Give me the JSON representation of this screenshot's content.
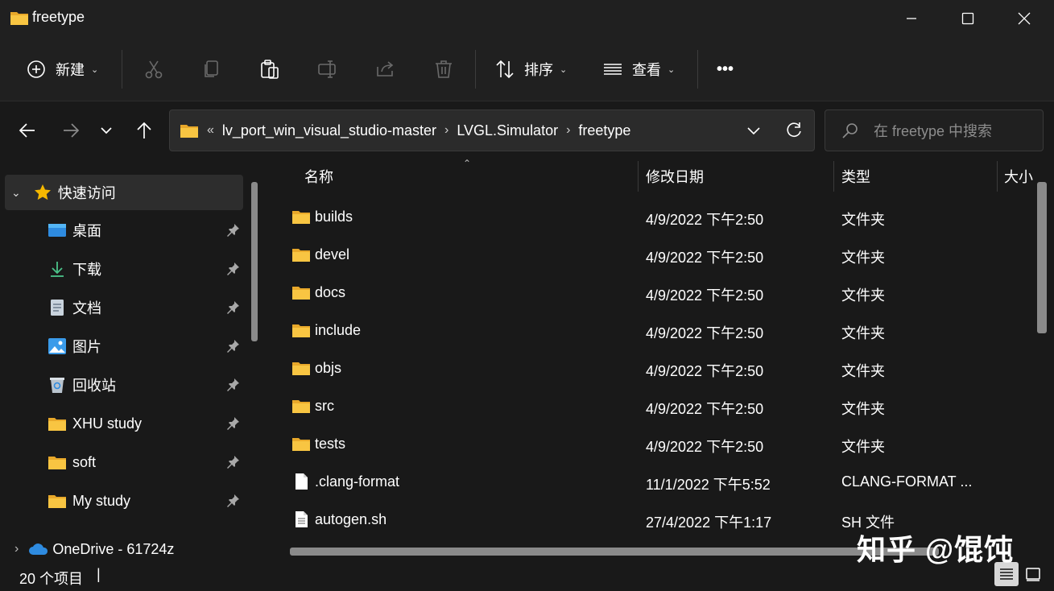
{
  "window": {
    "title": "freetype"
  },
  "toolbar": {
    "new_label": "新建",
    "sort_label": "排序",
    "view_label": "查看",
    "more_label": "•••"
  },
  "address": {
    "overflow": "«",
    "crumbs": [
      "lv_port_win_visual_studio-master",
      "LVGL.Simulator",
      "freetype"
    ],
    "separator": "›"
  },
  "search": {
    "placeholder": "在 freetype 中搜索"
  },
  "sidebar": {
    "quick_access": "快速访问",
    "items": [
      {
        "label": "桌面",
        "icon": "desktop-icon"
      },
      {
        "label": "下载",
        "icon": "download-icon"
      },
      {
        "label": "文档",
        "icon": "documents-icon"
      },
      {
        "label": "图片",
        "icon": "pictures-icon"
      },
      {
        "label": "回收站",
        "icon": "recycle-bin-icon"
      },
      {
        "label": "XHU study",
        "icon": "folder-icon"
      },
      {
        "label": "soft",
        "icon": "folder-icon"
      },
      {
        "label": "My study",
        "icon": "folder-icon"
      }
    ],
    "onedrive": "OneDrive - 61724z"
  },
  "columns": {
    "name": "名称",
    "date": "修改日期",
    "type": "类型",
    "size": "大小"
  },
  "files": [
    {
      "name": "builds",
      "date": "4/9/2022 下午2:50",
      "type": "文件夹",
      "kind": "folder"
    },
    {
      "name": "devel",
      "date": "4/9/2022 下午2:50",
      "type": "文件夹",
      "kind": "folder"
    },
    {
      "name": "docs",
      "date": "4/9/2022 下午2:50",
      "type": "文件夹",
      "kind": "folder"
    },
    {
      "name": "include",
      "date": "4/9/2022 下午2:50",
      "type": "文件夹",
      "kind": "folder"
    },
    {
      "name": "objs",
      "date": "4/9/2022 下午2:50",
      "type": "文件夹",
      "kind": "folder"
    },
    {
      "name": "src",
      "date": "4/9/2022 下午2:50",
      "type": "文件夹",
      "kind": "folder"
    },
    {
      "name": "tests",
      "date": "4/9/2022 下午2:50",
      "type": "文件夹",
      "kind": "folder"
    },
    {
      "name": ".clang-format",
      "date": "11/1/2022 下午5:52",
      "type": "CLANG-FORMAT ...",
      "kind": "file"
    },
    {
      "name": "autogen.sh",
      "date": "27/4/2022 下午1:17",
      "type": "SH 文件",
      "kind": "textfile"
    }
  ],
  "status": {
    "count": "20 个项目",
    "cursor": "|"
  },
  "watermark": "知乎 @馄饨",
  "colors": {
    "background": "#191919",
    "chrome": "#202020",
    "folder": "#F8C542"
  }
}
